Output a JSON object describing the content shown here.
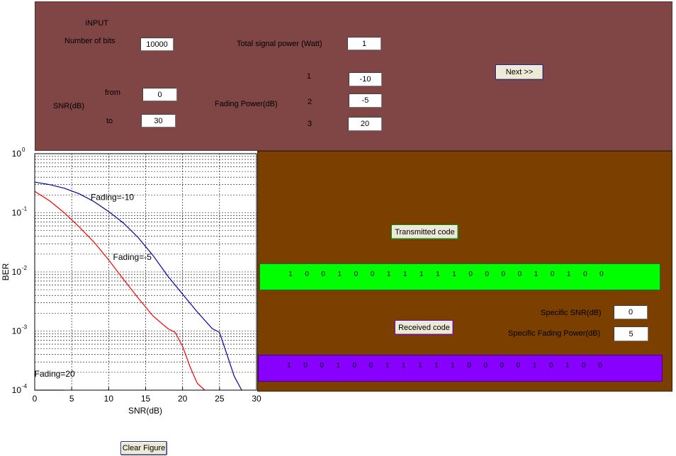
{
  "colors": {
    "input_panel": "#804545",
    "output_panel": "#7b3f00",
    "transmitted_bar": "#00ff00",
    "received_bar": "#8800ff",
    "curve_fading_minus10": "#0000aa",
    "curve_fading_minus5": "#ff0000",
    "curve_fading_20": "#00cc00"
  },
  "input": {
    "title": "INPUT",
    "num_bits_label": "Number of bits",
    "num_bits_value": "10000",
    "snr_label": "SNR(dB)",
    "from_label": "from",
    "from_value": "0",
    "to_label": "to",
    "to_value": "30",
    "total_power_label": "Total signal power (Watt)",
    "total_power_value": "1",
    "fading_power_label": "Fading Power(dB)",
    "fading_index_1": "1",
    "fading_index_2": "2",
    "fading_index_3": "3",
    "fading_1_value": "-10",
    "fading_2_value": "-5",
    "fading_3_value": "20",
    "next_button": "Next >>"
  },
  "output": {
    "transmitted_button": "Transmitted code",
    "received_button": "Received code",
    "specific_snr_label": "Specific SNR(dB)",
    "specific_snr_value": "0",
    "specific_fading_label": "Specific Fading Power(dB)",
    "specific_fading_value": "5",
    "transmitted_bits": [
      "1",
      "0",
      "0",
      "1",
      "0",
      "0",
      "1",
      "1",
      "1",
      "1",
      "1",
      "0",
      "0",
      "0",
      "0",
      "1",
      "0",
      "1",
      "0",
      "0"
    ],
    "received_bits": [
      "1",
      "0",
      "0",
      "1",
      "0",
      "0",
      "1",
      "1",
      "1",
      "1",
      "1",
      "0",
      "0",
      "0",
      "0",
      "1",
      "0",
      "1",
      "0",
      "0"
    ]
  },
  "clear_button": "Clear Figure",
  "chart_data": {
    "type": "line",
    "xlabel": "SNR(dB)",
    "ylabel": "BER",
    "xlim": [
      0,
      30
    ],
    "ylim": [
      0.0001,
      1
    ],
    "yscale": "log",
    "xticks": [
      "0",
      "5",
      "10",
      "15",
      "20",
      "25",
      "30"
    ],
    "yticks": [
      {
        "base": "10",
        "exp": "0"
      },
      {
        "base": "10",
        "exp": "-1"
      },
      {
        "base": "10",
        "exp": "-2"
      },
      {
        "base": "10",
        "exp": "-3"
      },
      {
        "base": "10",
        "exp": "-4"
      }
    ],
    "grid": true,
    "series": [
      {
        "name": "Fading=-10",
        "color": "#0000aa",
        "x": [
          0,
          2,
          4,
          6,
          8,
          10,
          12,
          14,
          16,
          18,
          20,
          22,
          24,
          25,
          26,
          27,
          28
        ],
        "y": [
          0.33,
          0.3,
          0.26,
          0.21,
          0.155,
          0.105,
          0.067,
          0.038,
          0.019,
          0.0085,
          0.0042,
          0.0021,
          0.0011,
          0.00095,
          0.0004,
          0.00017,
          0.0001
        ]
      },
      {
        "name": "Fading=-5",
        "color": "#ff0000",
        "x": [
          0,
          2,
          4,
          6,
          8,
          10,
          12,
          14,
          16,
          18,
          19,
          20,
          21,
          22,
          23
        ],
        "y": [
          0.23,
          0.16,
          0.1,
          0.058,
          0.032,
          0.016,
          0.0075,
          0.0036,
          0.0018,
          0.0011,
          0.00095,
          0.00055,
          0.00025,
          0.00013,
          0.0001
        ]
      },
      {
        "name": "Fading=20",
        "color": "#00cc00",
        "x": [
          0,
          4
        ],
        "y": [
          0.0001,
          0.0001
        ]
      }
    ],
    "annotations": [
      {
        "text": "Fading=-10",
        "x": 10.5,
        "y": 0.165
      },
      {
        "text": "Fading=-5",
        "x": 13.2,
        "y": 0.016
      },
      {
        "text": "Fading=20",
        "x": 2.7,
        "y": 0.00017
      }
    ]
  }
}
